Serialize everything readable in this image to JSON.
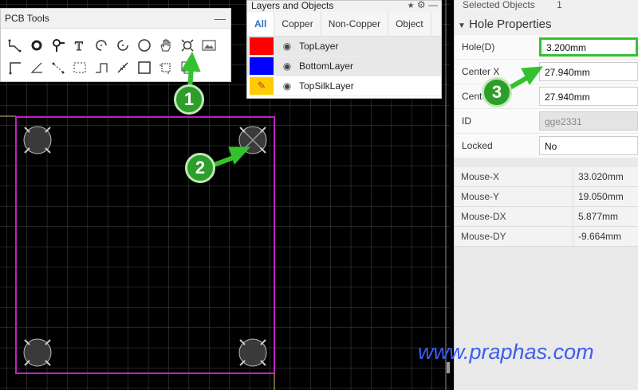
{
  "pcb_tools": {
    "title": "PCB Tools",
    "minimize": "—",
    "row1": [
      "wire-icon",
      "circle-ring-icon",
      "pin-icon",
      "text-icon",
      "arc-icon",
      "arc2-icon",
      "circle-icon",
      "hand-icon",
      "hole-icon",
      "image-icon"
    ],
    "row2": [
      "corner-icon",
      "angle-icon",
      "dotted-line-icon",
      "rect-dashed-icon",
      "step-icon",
      "measure-icon",
      "square-icon",
      "crop-icon",
      "copy-icon"
    ]
  },
  "layers": {
    "title": "Layers and Objects",
    "pin": "📌",
    "gear": "⚙",
    "minimize": "—",
    "tabs": [
      "All",
      "Copper",
      "Non-Copper",
      "Object"
    ],
    "items": [
      {
        "name": "TopLayer",
        "color": "#ff0000"
      },
      {
        "name": "BottomLayer",
        "color": "#0000ff"
      },
      {
        "name": "TopSilkLayer",
        "color": "#ffcc00"
      }
    ]
  },
  "selected_objects": {
    "label": "Selected Objects",
    "count": "1"
  },
  "hole_properties": {
    "title": "Hole Properties",
    "hole_label": "Hole(D)",
    "hole_value": "3.200mm",
    "cx_label": "Center X",
    "cx_value": "27.940mm",
    "cy_label": "Center Y",
    "cy_value": "27.940mm",
    "id_label": "ID",
    "id_value": "gge2331",
    "locked_label": "Locked",
    "locked_value": "No"
  },
  "mouse": [
    {
      "k": "Mouse-X",
      "v": "33.020mm"
    },
    {
      "k": "Mouse-Y",
      "v": "19.050mm"
    },
    {
      "k": "Mouse-DX",
      "v": "5.877mm"
    },
    {
      "k": "Mouse-DY",
      "v": "-9.664mm"
    }
  ],
  "steps": [
    "1",
    "2",
    "3"
  ],
  "watermark": "www.praphas.com"
}
